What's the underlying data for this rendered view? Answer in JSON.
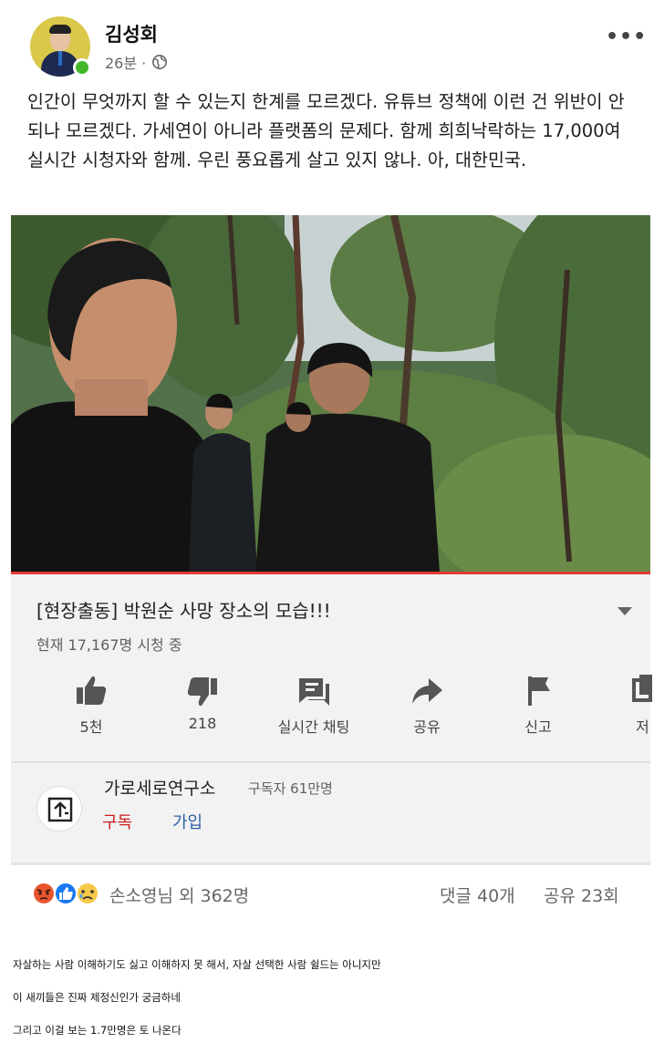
{
  "post": {
    "author": "김성회",
    "time": "26분 ·",
    "text": "인간이 무엇까지 할 수 있는지 한계를 모르겠다. 유튜브 정책에 이런 건 위반이 안되나 모르겠다. 가세연이 아니라 플랫폼의 문제다. 함께 희희낙락하는 17,000여 실시간 시청자와 함께. 우린 풍요롭게 살고 있지 않나. 아, 대한민국."
  },
  "video": {
    "title": "[현장출동] 박원순 사망 장소의 모습!!!",
    "viewers": "현재 17,167명 시청 중",
    "actions": [
      {
        "icon": "thumbs-up-icon",
        "label": "5천"
      },
      {
        "icon": "thumbs-down-icon",
        "label": "218"
      },
      {
        "icon": "live-chat-icon",
        "label": "실시간 채팅"
      },
      {
        "icon": "share-icon",
        "label": "공유"
      },
      {
        "icon": "flag-icon",
        "label": "신고"
      },
      {
        "icon": "save-icon",
        "label": "저"
      }
    ],
    "channel": {
      "name": "가로세로연구소",
      "subscribers": "구독자 61만명",
      "subscribe_label": "구독",
      "join_label": "가입"
    },
    "colors": {
      "progress": "#e53935",
      "subscribe": "#cc1e1e",
      "join": "#2d5fa8"
    }
  },
  "engagement": {
    "reaction_icons": [
      "angry-icon",
      "like-icon",
      "sad-icon"
    ],
    "reactions": "손소영님 외 362명",
    "comments": "댓글 40개",
    "shares": "공유 23회"
  },
  "captions": [
    "자살하는 사람 이해하기도 싫고 이해하지 못 해서, 자살 선택한 사람 쉴드는 아니지만",
    "이 새끼들은 진짜 제정신인가 궁금하네",
    "그리고 이걸 보는 1.7만명은 토 나온다"
  ]
}
